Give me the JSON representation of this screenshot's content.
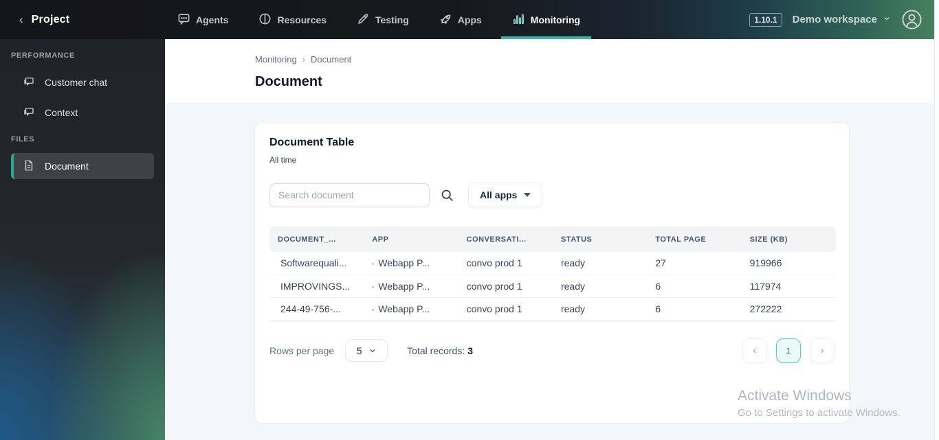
{
  "topbar": {
    "brand": "Project",
    "nav": [
      {
        "label": "Agents"
      },
      {
        "label": "Resources"
      },
      {
        "label": "Testing"
      },
      {
        "label": "Apps"
      },
      {
        "label": "Monitoring"
      }
    ],
    "version": "1.10.1",
    "workspace": "Demo workspace"
  },
  "sidebar": {
    "groups": [
      {
        "label": "PERFORMANCE",
        "items": [
          {
            "label": "Customer chat"
          },
          {
            "label": "Context"
          }
        ]
      },
      {
        "label": "FILES",
        "items": [
          {
            "label": "Document"
          }
        ]
      }
    ]
  },
  "breadcrumb": {
    "items": [
      "Monitoring",
      "Document"
    ],
    "separator": "›"
  },
  "page": {
    "title": "Document"
  },
  "card": {
    "title": "Document Table",
    "subtitle": "All time",
    "search_placeholder": "Search document",
    "filter_label": "All apps",
    "table": {
      "columns": [
        "DOCUMENT_...",
        "APP",
        "CONVERSATI...",
        "STATUS",
        "TOTAL PAGE",
        "SIZE (KB)"
      ],
      "rows": [
        [
          "Softwarequali...",
          "Webapp P...",
          "convo prod 1",
          "ready",
          "27",
          "919966"
        ],
        [
          "IMPROVINGS...",
          "Webapp P...",
          "convo prod 1",
          "ready",
          "6",
          "117974"
        ],
        [
          "244-49-756-...",
          "Webapp P...",
          "convo prod 1",
          "ready",
          "6",
          "272222"
        ]
      ]
    },
    "footer": {
      "rows_per_page_label": "Rows per page",
      "rows_per_page_value": "5",
      "total_records_label": "Total records:",
      "total_records_value": "3",
      "current_page": "1"
    }
  },
  "watermark": {
    "line1": "Activate Windows",
    "line2": "Go to Settings to activate Windows."
  },
  "colors": {
    "accent_teal": "#38b5a8",
    "active_page_border": "#4ed0c3",
    "status_ready": "#3a4452"
  }
}
